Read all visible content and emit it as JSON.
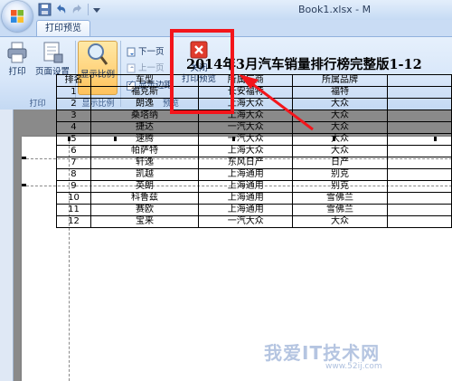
{
  "window": {
    "title": "Book1.xlsx - M"
  },
  "tabs": [
    {
      "label": "打印预览",
      "active": true
    }
  ],
  "ribbon": {
    "print_label": "打印",
    "page_setup_label": "页面设置",
    "zoom_label": "显示比例",
    "next_page_label": "下一页",
    "prev_page_label": "上一页",
    "show_margins_label": "显示边距",
    "show_margins_checked": true,
    "close_label_line1": "关闭",
    "close_label_line2": "打印预览",
    "groups": {
      "print": "打印",
      "zoom": "显示比例",
      "preview": "预览"
    }
  },
  "sheet": {
    "title": "2014年3月汽车销量排行榜完整版1-12",
    "headers": [
      "排名",
      "车型",
      "所属厂商",
      "所属品牌"
    ],
    "rows": [
      [
        "1",
        "福克斯",
        "长安福特",
        "福特"
      ],
      [
        "2",
        "朗逸",
        "上海大众",
        "大众"
      ],
      [
        "3",
        "桑塔纳",
        "上海大众",
        "大众"
      ],
      [
        "4",
        "捷达",
        "一汽大众",
        "大众"
      ],
      [
        "5",
        "速腾",
        "一汽大众",
        "大众"
      ],
      [
        "6",
        "帕萨特",
        "上海大众",
        "大众"
      ],
      [
        "7",
        "轩逸",
        "东风日产",
        "日产"
      ],
      [
        "8",
        "凯越",
        "上海通用",
        "别克"
      ],
      [
        "9",
        "英朗",
        "上海通用",
        "别克"
      ],
      [
        "10",
        "科鲁兹",
        "上海通用",
        "雪佛兰"
      ],
      [
        "11",
        "赛欧",
        "上海通用",
        "雪佛兰"
      ],
      [
        "12",
        "宝来",
        "一汽大众",
        "大众"
      ]
    ]
  },
  "watermark": {
    "text": "我爱IT技术网",
    "sub": "www.52ij.com"
  },
  "colors": {
    "highlight": "#f3151b",
    "ribbon": "#d7e6f9"
  }
}
